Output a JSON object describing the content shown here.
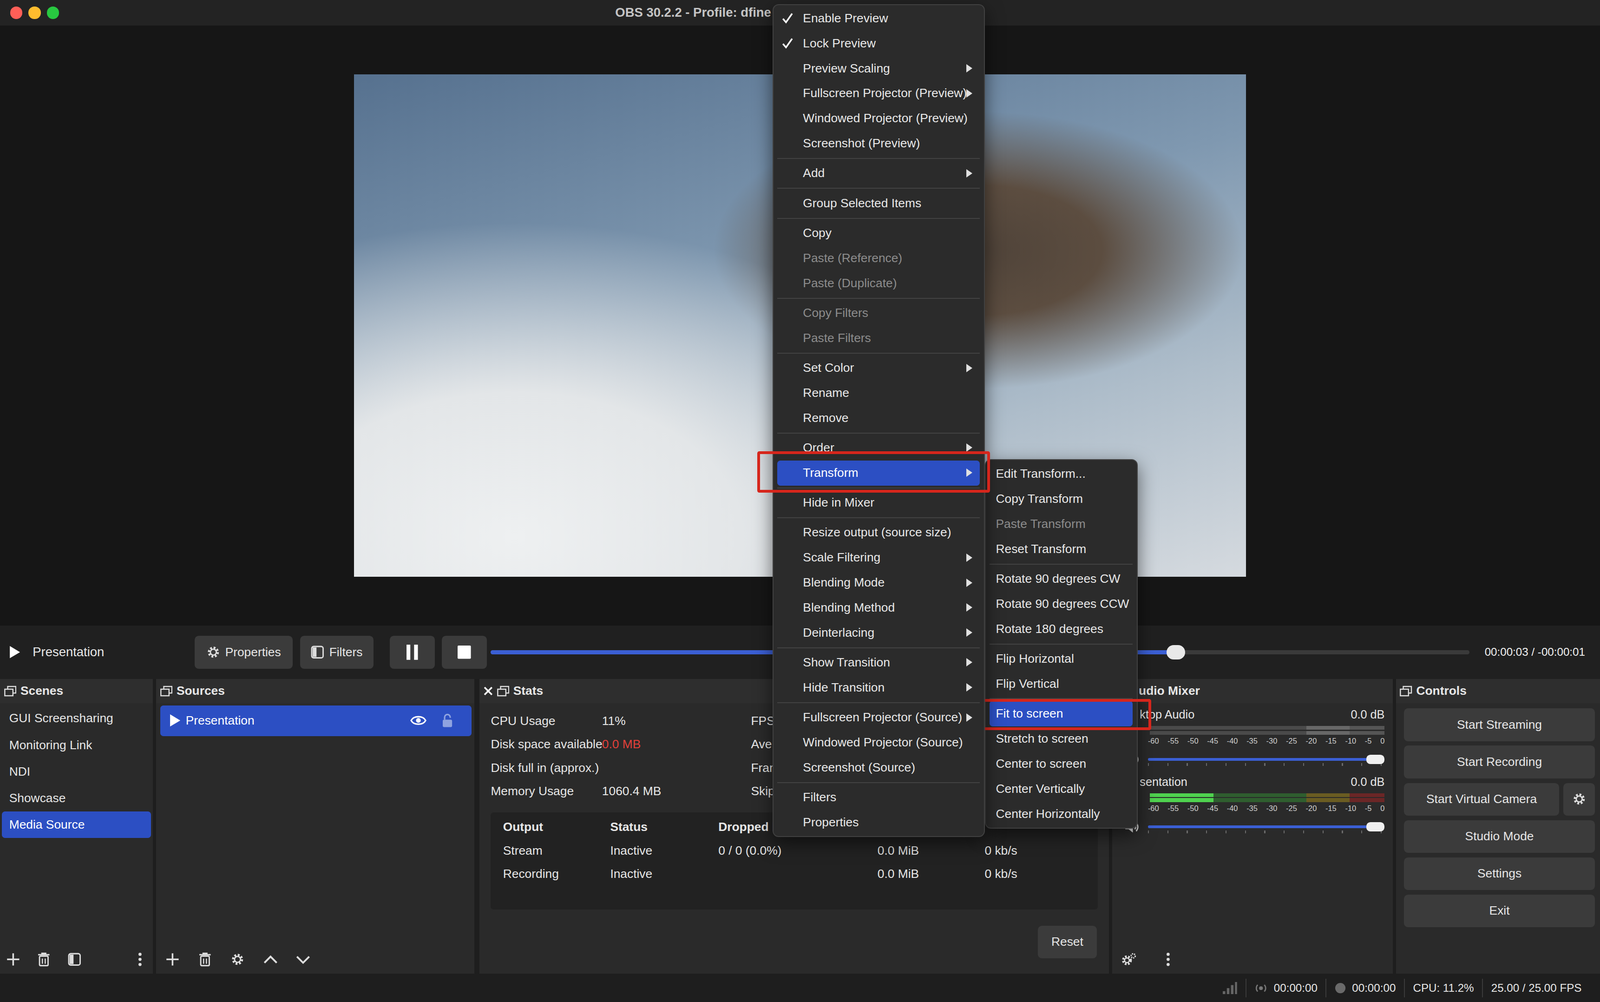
{
  "window": {
    "title": "OBS 30.2.2 - Profile: dfine"
  },
  "transport": {
    "source": "Presentation",
    "properties": "Properties",
    "filters": "Filters",
    "level": 0.7,
    "time": "00:00:03  /  -00:00:01"
  },
  "scenes": {
    "title": "Scenes",
    "items": [
      {
        "label": "GUI Screensharing",
        "selected": false
      },
      {
        "label": "Monitoring Link",
        "selected": false
      },
      {
        "label": "NDI",
        "selected": false
      },
      {
        "label": "Showcase",
        "selected": false
      },
      {
        "label": "Media Source",
        "selected": true
      }
    ]
  },
  "sources": {
    "title": "Sources",
    "items": [
      {
        "label": "Presentation",
        "selected": true,
        "visible": true,
        "locked": false
      }
    ]
  },
  "stats": {
    "title": "Stats",
    "rows": [
      {
        "label": "CPU Usage",
        "value": "11%",
        "alert": false
      },
      {
        "label": "Disk space available",
        "value": "0.0 MB",
        "alert": true
      },
      {
        "label": "Disk full in (approx.)",
        "value": null,
        "alert": false
      },
      {
        "label": "Memory Usage",
        "value": "1060.4 MB",
        "alert": false
      }
    ],
    "right_labels": [
      "FPS",
      "Ave",
      "Fran",
      "Skip"
    ],
    "columns": [
      "Output",
      "Status",
      "Dropped I"
    ],
    "output_rows": [
      [
        "Stream",
        "Inactive",
        "0 / 0 (0.0%)",
        "0.0 MiB",
        "0 kb/s"
      ],
      [
        "Recording",
        "Inactive",
        null,
        "0.0 MiB",
        "0 kb/s"
      ]
    ],
    "reset": "Reset"
  },
  "mixer": {
    "title": "udio Mixer",
    "ticks": [
      "-60",
      "-55",
      "-50",
      "-45",
      "-40",
      "-35",
      "-30",
      "-25",
      "-20",
      "-15",
      "-10",
      "-5",
      "0"
    ],
    "channels": [
      {
        "name": "ktop Audio",
        "reading": "0.0 dB",
        "active": false,
        "meter": 0,
        "volume": 1
      },
      {
        "name": "sentation",
        "reading": "0.0 dB",
        "active": true,
        "meter": 0.27,
        "volume": 1
      }
    ]
  },
  "controls": {
    "title": "Controls",
    "buttons": [
      {
        "label": "Start Streaming",
        "has_settings": false
      },
      {
        "label": "Start Recording",
        "has_settings": false
      },
      {
        "label": "Start Virtual Camera",
        "has_settings": true
      },
      {
        "label": "Studio Mode",
        "has_settings": false
      },
      {
        "label": "Settings",
        "has_settings": false
      },
      {
        "label": "Exit",
        "has_settings": false
      }
    ]
  },
  "status_bar": {
    "stream_time": "00:00:00",
    "record_time": "00:00:00",
    "cpu": "CPU: 11.2%",
    "fps": "25.00 / 25.00 FPS"
  },
  "context_menu": {
    "items": [
      {
        "kind": "item",
        "label": "Enable Preview",
        "checked": true,
        "submenu": false,
        "disabled": false,
        "selected": false,
        "highlighted": false
      },
      {
        "kind": "item",
        "label": "Lock Preview",
        "checked": true,
        "submenu": false,
        "disabled": false,
        "selected": false,
        "highlighted": false
      },
      {
        "kind": "item",
        "label": "Preview Scaling",
        "checked": false,
        "submenu": true,
        "disabled": false,
        "selected": false,
        "highlighted": false
      },
      {
        "kind": "item",
        "label": "Fullscreen Projector (Preview)",
        "checked": false,
        "submenu": true,
        "disabled": false,
        "selected": false,
        "highlighted": false
      },
      {
        "kind": "item",
        "label": "Windowed Projector (Preview)",
        "checked": false,
        "submenu": false,
        "disabled": false,
        "selected": false,
        "highlighted": false
      },
      {
        "kind": "item",
        "label": "Screenshot (Preview)",
        "checked": false,
        "submenu": false,
        "disabled": false,
        "selected": false,
        "highlighted": false
      },
      {
        "kind": "separator"
      },
      {
        "kind": "item",
        "label": "Add",
        "checked": false,
        "submenu": true,
        "disabled": false,
        "selected": false,
        "highlighted": false
      },
      {
        "kind": "separator"
      },
      {
        "kind": "item",
        "label": "Group Selected Items",
        "checked": false,
        "submenu": false,
        "disabled": false,
        "selected": false,
        "highlighted": false
      },
      {
        "kind": "separator"
      },
      {
        "kind": "item",
        "label": "Copy",
        "checked": false,
        "submenu": false,
        "disabled": false,
        "selected": false,
        "highlighted": false
      },
      {
        "kind": "item",
        "label": "Paste (Reference)",
        "checked": false,
        "submenu": false,
        "disabled": true,
        "selected": false,
        "highlighted": false
      },
      {
        "kind": "item",
        "label": "Paste (Duplicate)",
        "checked": false,
        "submenu": false,
        "disabled": true,
        "selected": false,
        "highlighted": false
      },
      {
        "kind": "separator"
      },
      {
        "kind": "item",
        "label": "Copy Filters",
        "checked": false,
        "submenu": false,
        "disabled": true,
        "selected": false,
        "highlighted": false
      },
      {
        "kind": "item",
        "label": "Paste Filters",
        "checked": false,
        "submenu": false,
        "disabled": true,
        "selected": false,
        "highlighted": false
      },
      {
        "kind": "separator"
      },
      {
        "kind": "item",
        "label": "Set Color",
        "checked": false,
        "submenu": true,
        "disabled": false,
        "selected": false,
        "highlighted": false
      },
      {
        "kind": "item",
        "label": "Rename",
        "checked": false,
        "submenu": false,
        "disabled": false,
        "selected": false,
        "highlighted": false
      },
      {
        "kind": "item",
        "label": "Remove",
        "checked": false,
        "submenu": false,
        "disabled": false,
        "selected": false,
        "highlighted": false
      },
      {
        "kind": "separator"
      },
      {
        "kind": "item",
        "label": "Order",
        "checked": false,
        "submenu": true,
        "disabled": false,
        "selected": false,
        "highlighted": false
      },
      {
        "kind": "item",
        "label": "Transform",
        "checked": false,
        "submenu": true,
        "disabled": false,
        "selected": true,
        "highlighted": true
      },
      {
        "kind": "separator"
      },
      {
        "kind": "item",
        "label": "Hide in Mixer",
        "checked": false,
        "submenu": false,
        "disabled": false,
        "selected": false,
        "highlighted": false
      },
      {
        "kind": "separator"
      },
      {
        "kind": "item",
        "label": "Resize output (source size)",
        "checked": false,
        "submenu": false,
        "disabled": false,
        "selected": false,
        "highlighted": false
      },
      {
        "kind": "item",
        "label": "Scale Filtering",
        "checked": false,
        "submenu": true,
        "disabled": false,
        "selected": false,
        "highlighted": false
      },
      {
        "kind": "item",
        "label": "Blending Mode",
        "checked": false,
        "submenu": true,
        "disabled": false,
        "selected": false,
        "highlighted": false
      },
      {
        "kind": "item",
        "label": "Blending Method",
        "checked": false,
        "submenu": true,
        "disabled": false,
        "selected": false,
        "highlighted": false
      },
      {
        "kind": "item",
        "label": "Deinterlacing",
        "checked": false,
        "submenu": true,
        "disabled": false,
        "selected": false,
        "highlighted": false
      },
      {
        "kind": "separator"
      },
      {
        "kind": "item",
        "label": "Show Transition",
        "checked": false,
        "submenu": true,
        "disabled": false,
        "selected": false,
        "highlighted": false
      },
      {
        "kind": "item",
        "label": "Hide Transition",
        "checked": false,
        "submenu": true,
        "disabled": false,
        "selected": false,
        "highlighted": false
      },
      {
        "kind": "separator"
      },
      {
        "kind": "item",
        "label": "Fullscreen Projector (Source)",
        "checked": false,
        "submenu": true,
        "disabled": false,
        "selected": false,
        "highlighted": false
      },
      {
        "kind": "item",
        "label": "Windowed Projector (Source)",
        "checked": false,
        "submenu": false,
        "disabled": false,
        "selected": false,
        "highlighted": false
      },
      {
        "kind": "item",
        "label": "Screenshot (Source)",
        "checked": false,
        "submenu": false,
        "disabled": false,
        "selected": false,
        "highlighted": false
      },
      {
        "kind": "separator"
      },
      {
        "kind": "item",
        "label": "Filters",
        "checked": false,
        "submenu": false,
        "disabled": false,
        "selected": false,
        "highlighted": false
      },
      {
        "kind": "item",
        "label": "Properties",
        "checked": false,
        "submenu": false,
        "disabled": false,
        "selected": false,
        "highlighted": false
      }
    ]
  },
  "transform_menu": {
    "items": [
      {
        "kind": "item",
        "label": "Edit Transform...",
        "checked": false,
        "submenu": false,
        "disabled": false,
        "selected": false,
        "highlighted": false
      },
      {
        "kind": "item",
        "label": "Copy Transform",
        "checked": false,
        "submenu": false,
        "disabled": false,
        "selected": false,
        "highlighted": false
      },
      {
        "kind": "item",
        "label": "Paste Transform",
        "checked": false,
        "submenu": false,
        "disabled": true,
        "selected": false,
        "highlighted": false
      },
      {
        "kind": "item",
        "label": "Reset Transform",
        "checked": false,
        "submenu": false,
        "disabled": false,
        "selected": false,
        "highlighted": false
      },
      {
        "kind": "separator"
      },
      {
        "kind": "item",
        "label": "Rotate 90 degrees CW",
        "checked": false,
        "submenu": false,
        "disabled": false,
        "selected": false,
        "highlighted": false
      },
      {
        "kind": "item",
        "label": "Rotate 90 degrees CCW",
        "checked": false,
        "submenu": false,
        "disabled": false,
        "selected": false,
        "highlighted": false
      },
      {
        "kind": "item",
        "label": "Rotate 180 degrees",
        "checked": false,
        "submenu": false,
        "disabled": false,
        "selected": false,
        "highlighted": false
      },
      {
        "kind": "separator"
      },
      {
        "kind": "item",
        "label": "Flip Horizontal",
        "checked": false,
        "submenu": false,
        "disabled": false,
        "selected": false,
        "highlighted": false
      },
      {
        "kind": "item",
        "label": "Flip Vertical",
        "checked": false,
        "submenu": false,
        "disabled": false,
        "selected": false,
        "highlighted": false
      },
      {
        "kind": "separator"
      },
      {
        "kind": "item",
        "label": "Fit to screen",
        "checked": false,
        "submenu": false,
        "disabled": false,
        "selected": true,
        "highlighted": true
      },
      {
        "kind": "item",
        "label": "Stretch to screen",
        "checked": false,
        "submenu": false,
        "disabled": false,
        "selected": false,
        "highlighted": false
      },
      {
        "kind": "item",
        "label": "Center to screen",
        "checked": false,
        "submenu": false,
        "disabled": false,
        "selected": false,
        "highlighted": false
      },
      {
        "kind": "item",
        "label": "Center Vertically",
        "checked": false,
        "submenu": false,
        "disabled": false,
        "selected": false,
        "highlighted": false
      },
      {
        "kind": "item",
        "label": "Center Horizontally",
        "checked": false,
        "submenu": false,
        "disabled": false,
        "selected": false,
        "highlighted": false
      }
    ]
  }
}
